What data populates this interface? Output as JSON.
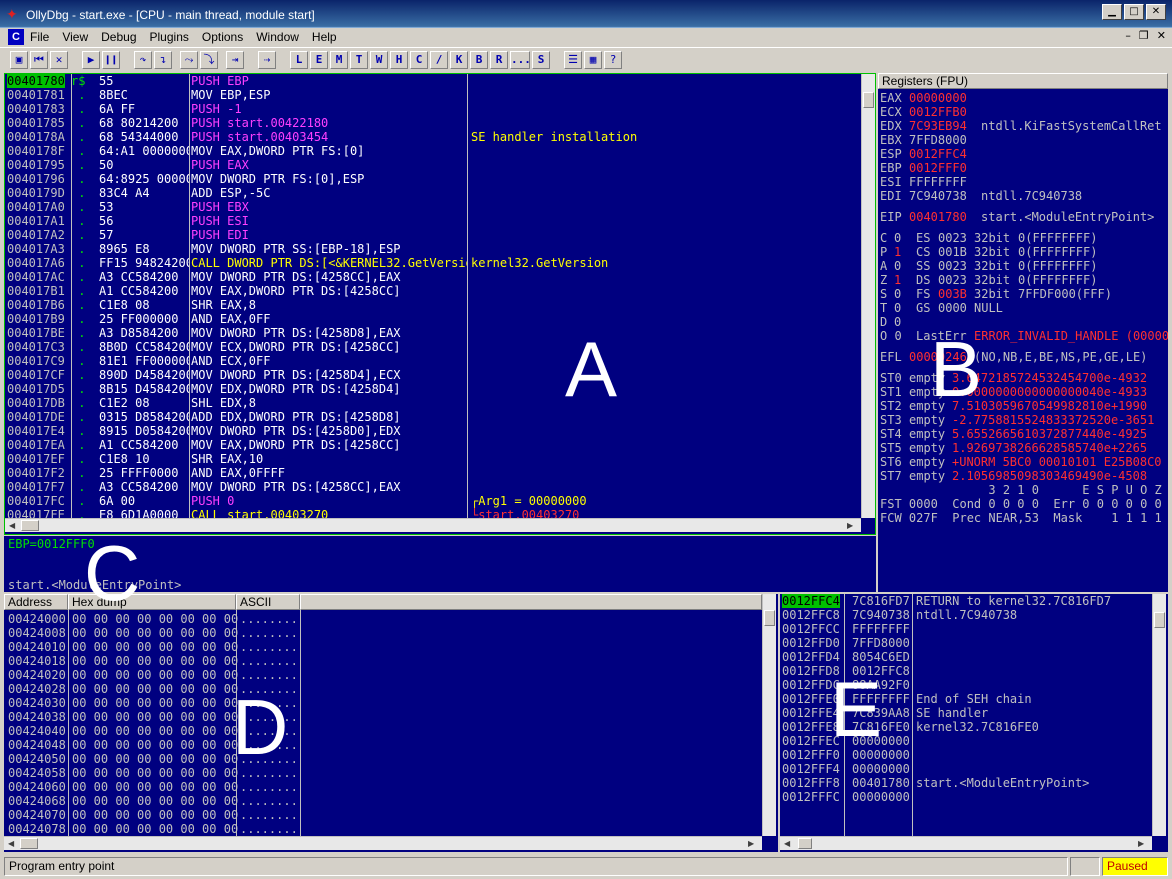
{
  "window": {
    "title": "OllyDbg - start.exe - [CPU - main thread, module start]",
    "logo": "✦",
    "btn_min": "▁",
    "btn_max": "□",
    "btn_close": "✕"
  },
  "menu": {
    "app_icon": "C",
    "items": [
      "File",
      "View",
      "Debug",
      "Plugins",
      "Options",
      "Window",
      "Help"
    ],
    "mdi_min": "–",
    "mdi_restore": "❐",
    "mdi_close": "✕"
  },
  "toolbar": {
    "icons": [
      "▣",
      "⏮",
      "✕",
      "▶",
      "❙❙",
      "↷",
      "↴",
      "⤳",
      "⤵",
      "⇥",
      "⇢"
    ],
    "letters": [
      "L",
      "E",
      "M",
      "T",
      "W",
      "H",
      "C",
      "/",
      "K",
      "B",
      "R",
      "...",
      "S"
    ],
    "tail_icons": [
      "☰",
      "▦",
      "?"
    ]
  },
  "disasm": {
    "rows": [
      {
        "addr": "00401780",
        "mark": "r$",
        "hex": "55",
        "instr": "PUSH EBP",
        "comment": "",
        "hl": true
      },
      {
        "addr": "00401781",
        "mark": " .",
        "hex": "8BEC",
        "instr": "MOV EBP,ESP",
        "comment": ""
      },
      {
        "addr": "00401783",
        "mark": " .",
        "hex": "6A FF",
        "instr": "PUSH -1",
        "comment": ""
      },
      {
        "addr": "00401785",
        "mark": " .",
        "hex": "68 80214200",
        "instr": "PUSH start.00422180",
        "comment": ""
      },
      {
        "addr": "0040178A",
        "mark": " .",
        "hex": "68 54344000",
        "instr": "PUSH start.00403454",
        "comment": "SE handler installation"
      },
      {
        "addr": "0040178F",
        "mark": " .",
        "hex": "64:A1 0000000",
        "instr": "MOV EAX,DWORD PTR FS:[0]",
        "comment": ""
      },
      {
        "addr": "00401795",
        "mark": " .",
        "hex": "50",
        "instr": "PUSH EAX",
        "comment": ""
      },
      {
        "addr": "00401796",
        "mark": " .",
        "hex": "64:8925 00000",
        "instr": "MOV DWORD PTR FS:[0],ESP",
        "comment": ""
      },
      {
        "addr": "0040179D",
        "mark": " .",
        "hex": "83C4 A4",
        "instr": "ADD ESP,-5C",
        "comment": ""
      },
      {
        "addr": "004017A0",
        "mark": " .",
        "hex": "53",
        "instr": "PUSH EBX",
        "comment": ""
      },
      {
        "addr": "004017A1",
        "mark": " .",
        "hex": "56",
        "instr": "PUSH ESI",
        "comment": ""
      },
      {
        "addr": "004017A2",
        "mark": " .",
        "hex": "57",
        "instr": "PUSH EDI",
        "comment": ""
      },
      {
        "addr": "004017A3",
        "mark": " .",
        "hex": "8965 E8",
        "instr": "MOV DWORD PTR SS:[EBP-18],ESP",
        "comment": ""
      },
      {
        "addr": "004017A6",
        "mark": " .",
        "hex": "FF15 94824200",
        "instr": "CALL DWORD PTR DS:[<&KERNEL32.GetVersion",
        "comment": "kernel32.GetVersion"
      },
      {
        "addr": "004017AC",
        "mark": " .",
        "hex": "A3 CC584200",
        "instr": "MOV DWORD PTR DS:[4258CC],EAX",
        "comment": ""
      },
      {
        "addr": "004017B1",
        "mark": " .",
        "hex": "A1 CC584200",
        "instr": "MOV EAX,DWORD PTR DS:[4258CC]",
        "comment": ""
      },
      {
        "addr": "004017B6",
        "mark": " .",
        "hex": "C1E8 08",
        "instr": "SHR EAX,8",
        "comment": ""
      },
      {
        "addr": "004017B9",
        "mark": " .",
        "hex": "25 FF000000",
        "instr": "AND EAX,0FF",
        "comment": ""
      },
      {
        "addr": "004017BE",
        "mark": " .",
        "hex": "A3 D8584200",
        "instr": "MOV DWORD PTR DS:[4258D8],EAX",
        "comment": ""
      },
      {
        "addr": "004017C3",
        "mark": " .",
        "hex": "8B0D CC584200",
        "instr": "MOV ECX,DWORD PTR DS:[4258CC]",
        "comment": ""
      },
      {
        "addr": "004017C9",
        "mark": " .",
        "hex": "81E1 FF000000",
        "instr": "AND ECX,0FF",
        "comment": ""
      },
      {
        "addr": "004017CF",
        "mark": " .",
        "hex": "890D D4584200",
        "instr": "MOV DWORD PTR DS:[4258D4],ECX",
        "comment": ""
      },
      {
        "addr": "004017D5",
        "mark": " .",
        "hex": "8B15 D4584200",
        "instr": "MOV EDX,DWORD PTR DS:[4258D4]",
        "comment": ""
      },
      {
        "addr": "004017DB",
        "mark": " .",
        "hex": "C1E2 08",
        "instr": "SHL EDX,8",
        "comment": ""
      },
      {
        "addr": "004017DE",
        "mark": " .",
        "hex": "0315 D8584200",
        "instr": "ADD EDX,DWORD PTR DS:[4258D8]",
        "comment": ""
      },
      {
        "addr": "004017E4",
        "mark": " .",
        "hex": "8915 D0584200",
        "instr": "MOV DWORD PTR DS:[4258D0],EDX",
        "comment": ""
      },
      {
        "addr": "004017EA",
        "mark": " .",
        "hex": "A1 CC584200",
        "instr": "MOV EAX,DWORD PTR DS:[4258CC]",
        "comment": ""
      },
      {
        "addr": "004017EF",
        "mark": " .",
        "hex": "C1E8 10",
        "instr": "SHR EAX,10",
        "comment": ""
      },
      {
        "addr": "004017F2",
        "mark": " .",
        "hex": "25 FFFF0000",
        "instr": "AND EAX,0FFFF",
        "comment": ""
      },
      {
        "addr": "004017F7",
        "mark": " .",
        "hex": "A3 CC584200",
        "instr": "MOV DWORD PTR DS:[4258CC],EAX",
        "comment": ""
      },
      {
        "addr": "004017FC",
        "mark": " .",
        "hex": "6A 00",
        "instr": "PUSH 0",
        "comment": "┌Arg1 = 00000000"
      },
      {
        "addr": "004017FE",
        "mark": " .",
        "hex": "E8 6D1A0000",
        "instr": "CALL start.00403270",
        "comment": "└start.00403270"
      }
    ]
  },
  "info": {
    "line1": "EBP=0012FFF0",
    "line2": "start.<ModuleEntryPoint>"
  },
  "registers": {
    "header": "Registers (FPU)",
    "general": [
      {
        "name": "EAX",
        "value": "00000000",
        "desc": "",
        "changed": true
      },
      {
        "name": "ECX",
        "value": "0012FFB0",
        "desc": "",
        "changed": true
      },
      {
        "name": "EDX",
        "value": "7C93EB94",
        "desc": "ntdll.KiFastSystemCallRet",
        "changed": true
      },
      {
        "name": "EBX",
        "value": "7FFD8000",
        "desc": "",
        "changed": false
      },
      {
        "name": "ESP",
        "value": "0012FFC4",
        "desc": "",
        "changed": true
      },
      {
        "name": "EBP",
        "value": "0012FFF0",
        "desc": "",
        "changed": true
      },
      {
        "name": "ESI",
        "value": "FFFFFFFF",
        "desc": "",
        "changed": false
      },
      {
        "name": "EDI",
        "value": "7C940738",
        "desc": "ntdll.7C940738",
        "changed": false
      }
    ],
    "eip": {
      "name": "EIP",
      "value": "00401780",
      "desc": "start.<ModuleEntryPoint>"
    },
    "flags": [
      {
        "f": "C",
        "v": "0",
        "seg": "ES",
        "sel": "0023",
        "bits": "32bit",
        "base": "0(FFFFFFFF)",
        "vred": false,
        "selred": false
      },
      {
        "f": "P",
        "v": "1",
        "seg": "CS",
        "sel": "001B",
        "bits": "32bit",
        "base": "0(FFFFFFFF)",
        "vred": true,
        "selred": false
      },
      {
        "f": "A",
        "v": "0",
        "seg": "SS",
        "sel": "0023",
        "bits": "32bit",
        "base": "0(FFFFFFFF)",
        "vred": false,
        "selred": false
      },
      {
        "f": "Z",
        "v": "1",
        "seg": "DS",
        "sel": "0023",
        "bits": "32bit",
        "base": "0(FFFFFFFF)",
        "vred": true,
        "selred": false
      },
      {
        "f": "S",
        "v": "0",
        "seg": "FS",
        "sel": "003B",
        "bits": "32bit",
        "base": "7FFDF000(FFF)",
        "vred": false,
        "selred": true
      },
      {
        "f": "T",
        "v": "0",
        "seg": "GS",
        "sel": "0000",
        "bits": "NULL",
        "base": "",
        "vred": false,
        "selred": false
      },
      {
        "f": "D",
        "v": "0",
        "seg": "",
        "sel": "",
        "bits": "",
        "base": "",
        "vred": false,
        "selred": false
      }
    ],
    "lasterr_flag": "O 0",
    "lasterr_label": "LastErr",
    "lasterr_value": "ERROR_INVALID_HANDLE (00000006)",
    "efl_label": "EFL",
    "efl_value": "00000246",
    "efl_desc": "(NO,NB,E,BE,NS,PE,GE,LE)",
    "fpu": [
      {
        "name": "ST0",
        "tag": "empty",
        "val": "3.6472185724532454700e-4932"
      },
      {
        "name": "ST1",
        "tag": "empty",
        "val": "0.0000000000000000040e-4933"
      },
      {
        "name": "ST2",
        "tag": "empty",
        "val": "7.5103059670549982810e+1990"
      },
      {
        "name": "ST3",
        "tag": "empty",
        "val": "-2.7758815524833372520e-3651"
      },
      {
        "name": "ST4",
        "tag": "empty",
        "val": "5.6552665610372877440e-4925"
      },
      {
        "name": "ST5",
        "tag": "empty",
        "val": "1.9269738266628585740e+2265"
      },
      {
        "name": "ST6",
        "tag": "empty",
        "val": "+UNORM 5BC0 00010101 E25B08C0"
      },
      {
        "name": "ST7",
        "tag": "empty",
        "val": "2.1056985098303469490e-4508"
      }
    ],
    "fpu_bits_header": "               3 2 1 0      E S P U O Z D I",
    "fst_line": "FST 0000  Cond 0 0 0 0  Err 0 0 0 0 0 0 0 0 (GT)",
    "fcw_line": "FCW 027F  Prec NEAR,53  Mask    1 1 1 1 1 1"
  },
  "dump": {
    "headers": {
      "address": "Address",
      "hex": "Hex dump",
      "ascii": "ASCII"
    },
    "rows": [
      {
        "addr": "00424000",
        "hex": "00 00 00 00 00 00 00 00",
        "ascii": "........"
      },
      {
        "addr": "00424008",
        "hex": "00 00 00 00 00 00 00 00",
        "ascii": "........"
      },
      {
        "addr": "00424010",
        "hex": "00 00 00 00 00 00 00 00",
        "ascii": "........"
      },
      {
        "addr": "00424018",
        "hex": "00 00 00 00 00 00 00 00",
        "ascii": "........"
      },
      {
        "addr": "00424020",
        "hex": "00 00 00 00 00 00 00 00",
        "ascii": "........"
      },
      {
        "addr": "00424028",
        "hex": "00 00 00 00 00 00 00 00",
        "ascii": "........"
      },
      {
        "addr": "00424030",
        "hex": "00 00 00 00 00 00 00 00",
        "ascii": "........"
      },
      {
        "addr": "00424038",
        "hex": "00 00 00 00 00 00 00 00",
        "ascii": "........"
      },
      {
        "addr": "00424040",
        "hex": "00 00 00 00 00 00 00 00",
        "ascii": "........"
      },
      {
        "addr": "00424048",
        "hex": "00 00 00 00 00 00 00 00",
        "ascii": "........"
      },
      {
        "addr": "00424050",
        "hex": "00 00 00 00 00 00 00 00",
        "ascii": "........"
      },
      {
        "addr": "00424058",
        "hex": "00 00 00 00 00 00 00 00",
        "ascii": "........"
      },
      {
        "addr": "00424060",
        "hex": "00 00 00 00 00 00 00 00",
        "ascii": "........"
      },
      {
        "addr": "00424068",
        "hex": "00 00 00 00 00 00 00 00",
        "ascii": "........"
      },
      {
        "addr": "00424070",
        "hex": "00 00 00 00 00 00 00 00",
        "ascii": "........"
      },
      {
        "addr": "00424078",
        "hex": "00 00 00 00 00 00 00 00",
        "ascii": "........"
      }
    ]
  },
  "stack": {
    "rows": [
      {
        "addr": "0012FFC4",
        "val": "7C816FD7",
        "comment": "RETURN to kernel32.7C816FD7",
        "hl": true
      },
      {
        "addr": "0012FFC8",
        "val": "7C940738",
        "comment": "ntdll.7C940738"
      },
      {
        "addr": "0012FFCC",
        "val": "FFFFFFFF",
        "comment": ""
      },
      {
        "addr": "0012FFD0",
        "val": "7FFD8000",
        "comment": ""
      },
      {
        "addr": "0012FFD4",
        "val": "8054C6ED",
        "comment": ""
      },
      {
        "addr": "0012FFD8",
        "val": "0012FFC8",
        "comment": ""
      },
      {
        "addr": "0012FFDC",
        "val": "88AA92F0",
        "comment": ""
      },
      {
        "addr": "0012FFE0",
        "val": "FFFFFFFF",
        "comment": "End of SEH chain"
      },
      {
        "addr": "0012FFE4",
        "val": "7C839AA8",
        "comment": "SE handler"
      },
      {
        "addr": "0012FFE8",
        "val": "7C816FE0",
        "comment": "kernel32.7C816FE0"
      },
      {
        "addr": "0012FFEC",
        "val": "00000000",
        "comment": ""
      },
      {
        "addr": "0012FFF0",
        "val": "00000000",
        "comment": ""
      },
      {
        "addr": "0012FFF4",
        "val": "00000000",
        "comment": ""
      },
      {
        "addr": "0012FFF8",
        "val": "00401780",
        "comment": "start.<ModuleEntryPoint>"
      },
      {
        "addr": "0012FFFC",
        "val": "00000000",
        "comment": ""
      }
    ]
  },
  "overlays": {
    "a": "A",
    "b": "B",
    "c": "C",
    "d": "D",
    "e": "E"
  },
  "status": {
    "message": "Program entry point",
    "state": "Paused",
    "state_color": "#ffff00"
  },
  "colors": {
    "pane_bg": "#000080",
    "highlight": "#00c000",
    "changed": "#ff3030"
  }
}
